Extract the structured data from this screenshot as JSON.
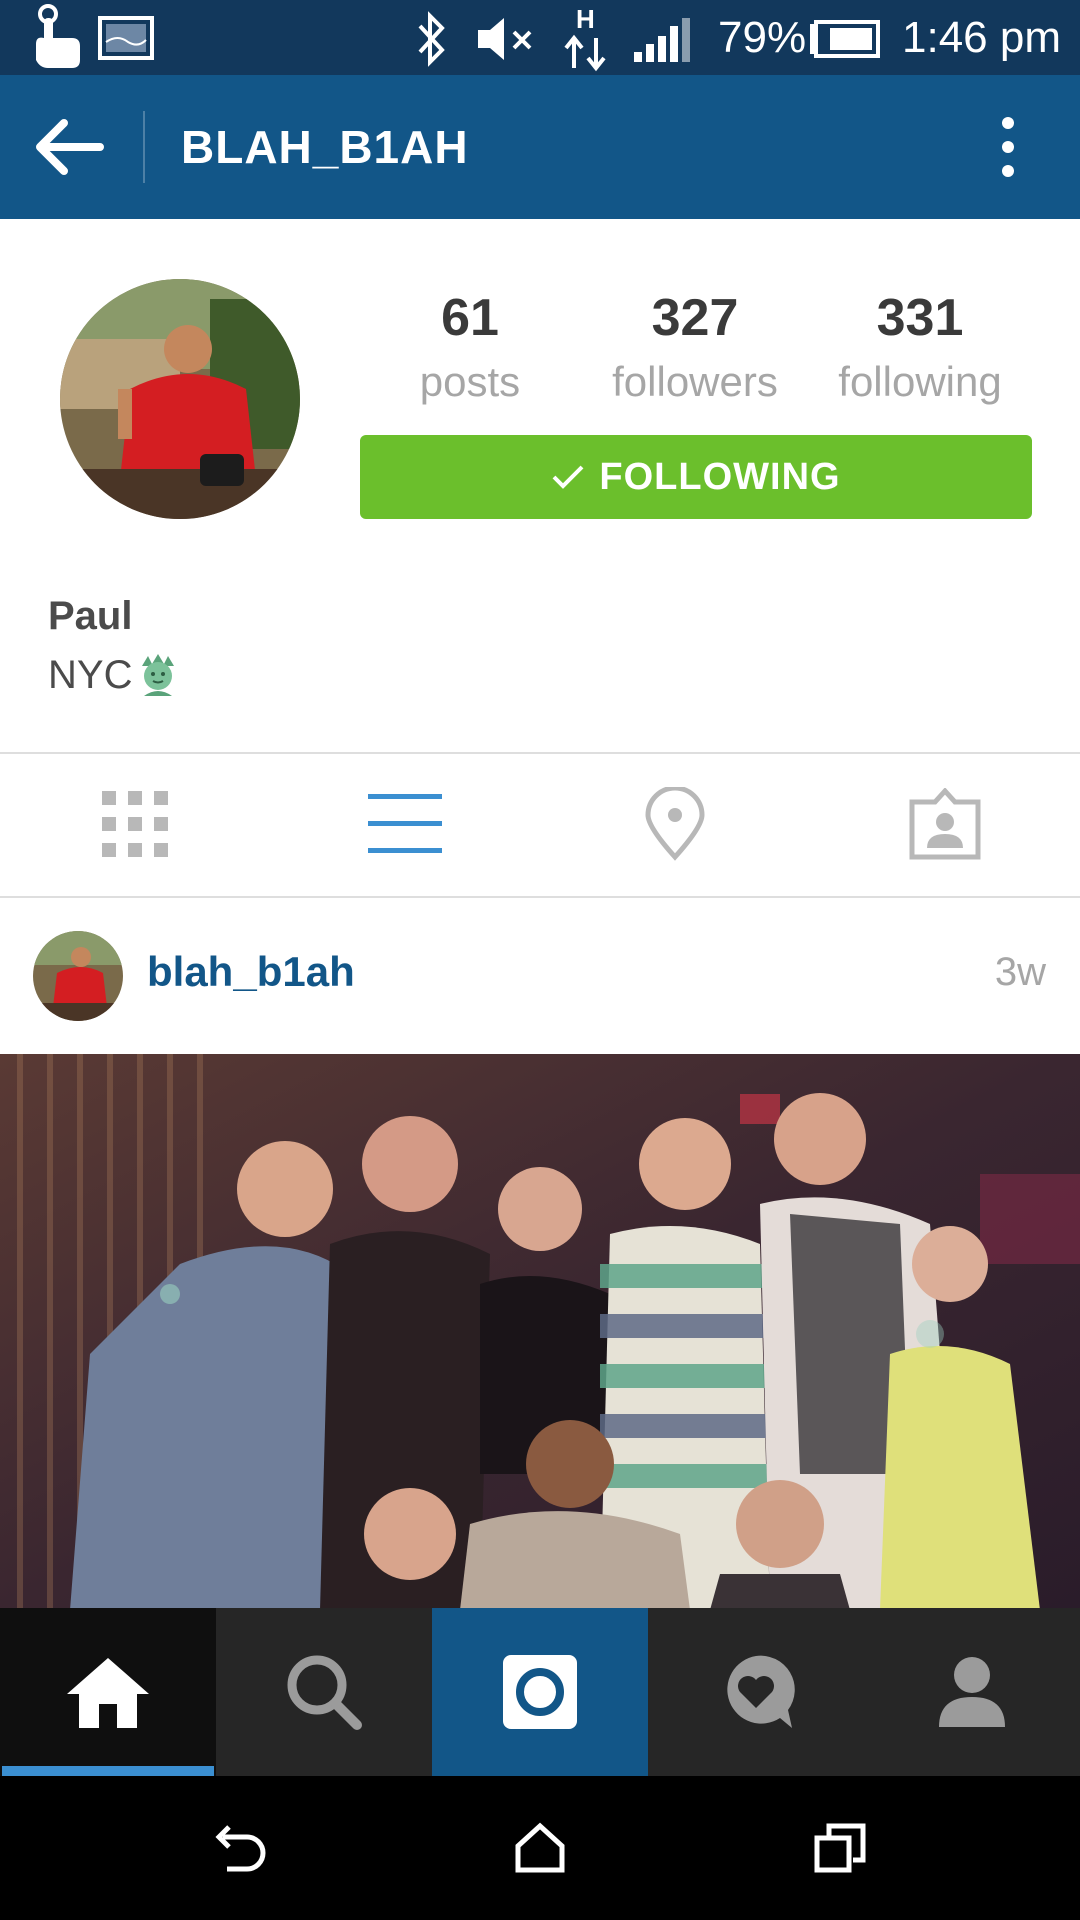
{
  "status_bar": {
    "battery_percent": "79%",
    "time": "1:46 pm",
    "icons": [
      "touch-icon",
      "gallery-icon",
      "bluetooth-icon",
      "mute-icon",
      "data-hplus-icon",
      "signal-icon",
      "battery-icon"
    ]
  },
  "app_bar": {
    "title": "BLAH_B1AH",
    "icons": [
      "back-arrow-icon",
      "more-vert-icon"
    ]
  },
  "profile": {
    "stats": [
      {
        "value": "61",
        "label": "posts"
      },
      {
        "value": "327",
        "label": "followers"
      },
      {
        "value": "331",
        "label": "following"
      }
    ],
    "follow_button_label": "FOLLOWING",
    "name": "Paul",
    "bio": "NYC"
  },
  "tabs": [
    {
      "icon": "grid-icon",
      "active": false
    },
    {
      "icon": "list-icon",
      "active": true
    },
    {
      "icon": "location-pin-icon",
      "active": false
    },
    {
      "icon": "tagged-photos-icon",
      "active": false
    }
  ],
  "post": {
    "username": "blah_b1ah",
    "time_ago": "3w"
  },
  "bottom_nav": [
    {
      "icon": "home-icon",
      "active": true
    },
    {
      "icon": "search-icon",
      "active": false
    },
    {
      "icon": "camera-icon",
      "active": false
    },
    {
      "icon": "activity-heart-icon",
      "active": false
    },
    {
      "icon": "profile-icon",
      "active": false
    }
  ],
  "system_nav": [
    "back-icon",
    "home-outline-icon",
    "recents-icon"
  ],
  "colors": {
    "status_bar": "#12385c",
    "app_bar": "#125688",
    "follow_button": "#6bbf2c",
    "active_tab": "#3b8fd1",
    "username_link": "#125688",
    "muted_text": "#a6a6a6"
  }
}
